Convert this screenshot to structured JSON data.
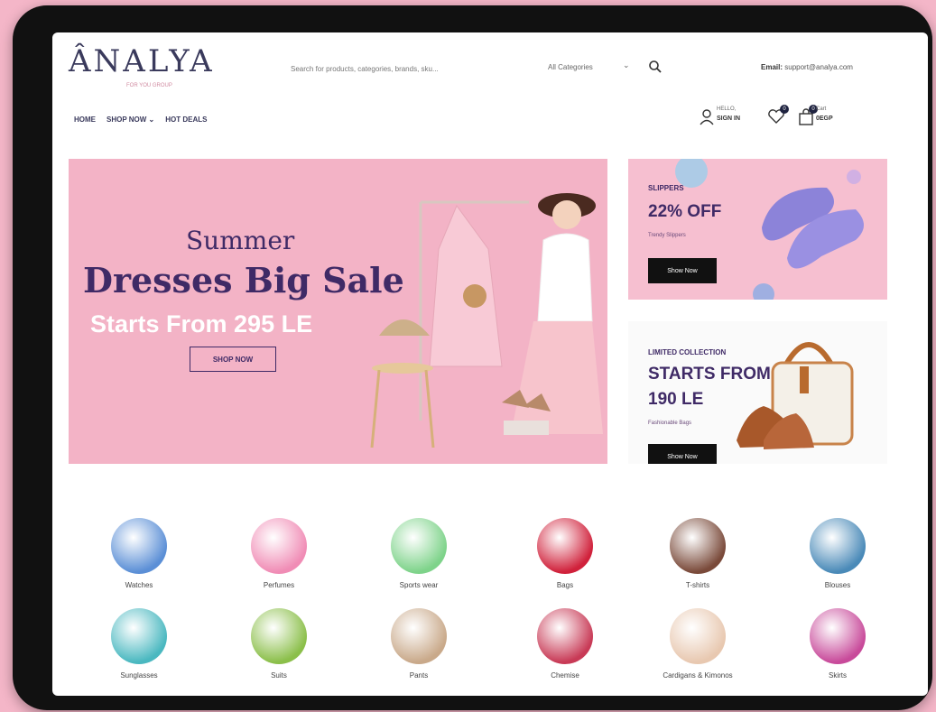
{
  "brand": {
    "logo": "ÂNALYA",
    "tagline": "FOR YOU GROUP"
  },
  "search": {
    "placeholder": "Search for products, categories, brands, sku...",
    "category": "All Categories"
  },
  "contact": {
    "email_label": "Email:",
    "email": "support@analya.com"
  },
  "nav": {
    "home": "HOME",
    "shop_now": "SHOP NOW ⌄",
    "hot_deals": "HOT DEALS"
  },
  "account": {
    "hello": "HELLO,",
    "sign_in": "SIGN IN",
    "wishlist_count": "0",
    "cart_count": "0",
    "cart_label": "Cart",
    "cart_total": "0EGP"
  },
  "hero": {
    "line1": "Summer",
    "line2": "Dresses Big Sale",
    "line3": "Starts From 295 LE",
    "button": "SHOP NOW"
  },
  "promo1": {
    "tag": "SLIPPERS",
    "headline": "22% OFF",
    "sub": "Trendy Slippers",
    "button": "Show Now"
  },
  "promo2": {
    "tag": "LIMITED COLLECTION",
    "headline1": "STARTS FROM",
    "headline2": "190 LE",
    "sub": "Fashionable Bags",
    "button": "Show Now"
  },
  "categories": [
    {
      "label": "Watches",
      "color": "#5b8fd6"
    },
    {
      "label": "Perfumes",
      "color": "#f08cb5"
    },
    {
      "label": "Sports wear",
      "color": "#7ed38a"
    },
    {
      "label": "Bags",
      "color": "#d0213b"
    },
    {
      "label": "T-shirts",
      "color": "#7a4a3a"
    },
    {
      "label": "Blouses",
      "color": "#4a8ab8"
    },
    {
      "label": "Sunglasses",
      "color": "#4ab8c0"
    },
    {
      "label": "Suits",
      "color": "#8bbf4a"
    },
    {
      "label": "Pants",
      "color": "#c9a98a"
    },
    {
      "label": "Chemise",
      "color": "#c83a56"
    },
    {
      "label": "Cardigans & Kimonos",
      "color": "#e8c8b0"
    },
    {
      "label": "Skirts",
      "color": "#c84a9a"
    }
  ]
}
